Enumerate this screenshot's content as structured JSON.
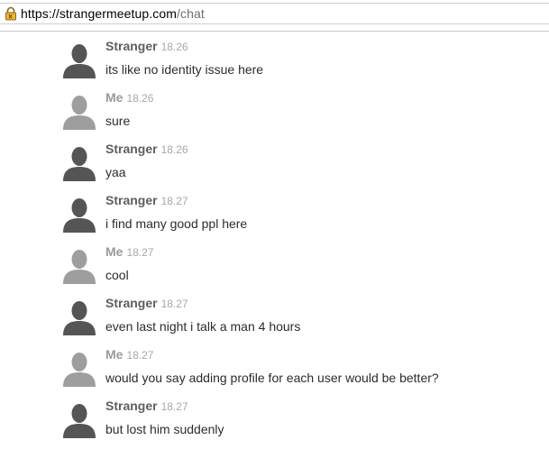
{
  "browser": {
    "url_host": "https://strangermeetup.com",
    "url_path": "/chat"
  },
  "colors": {
    "stranger_avatar": "#555555",
    "me_avatar": "#9e9e9e",
    "stranger_name": "#5e5e5e",
    "me_name": "#9a9a9a",
    "timestamp": "#a8a8a8",
    "message_text": "#2c2c2c"
  },
  "messages": [
    {
      "sender": "Stranger",
      "time": "18.26",
      "text": "its like no identity issue here"
    },
    {
      "sender": "Me",
      "time": "18.26",
      "text": "sure"
    },
    {
      "sender": "Stranger",
      "time": "18.26",
      "text": "yaa"
    },
    {
      "sender": "Stranger",
      "time": "18.27",
      "text": "i find many good ppl here"
    },
    {
      "sender": "Me",
      "time": "18.27",
      "text": "cool"
    },
    {
      "sender": "Stranger",
      "time": "18.27",
      "text": "even last night i talk a man 4 hours"
    },
    {
      "sender": "Me",
      "time": "18.27",
      "text": "would you say adding profile for each user would be better?"
    },
    {
      "sender": "Stranger",
      "time": "18.27",
      "text": "but lost him suddenly"
    }
  ]
}
